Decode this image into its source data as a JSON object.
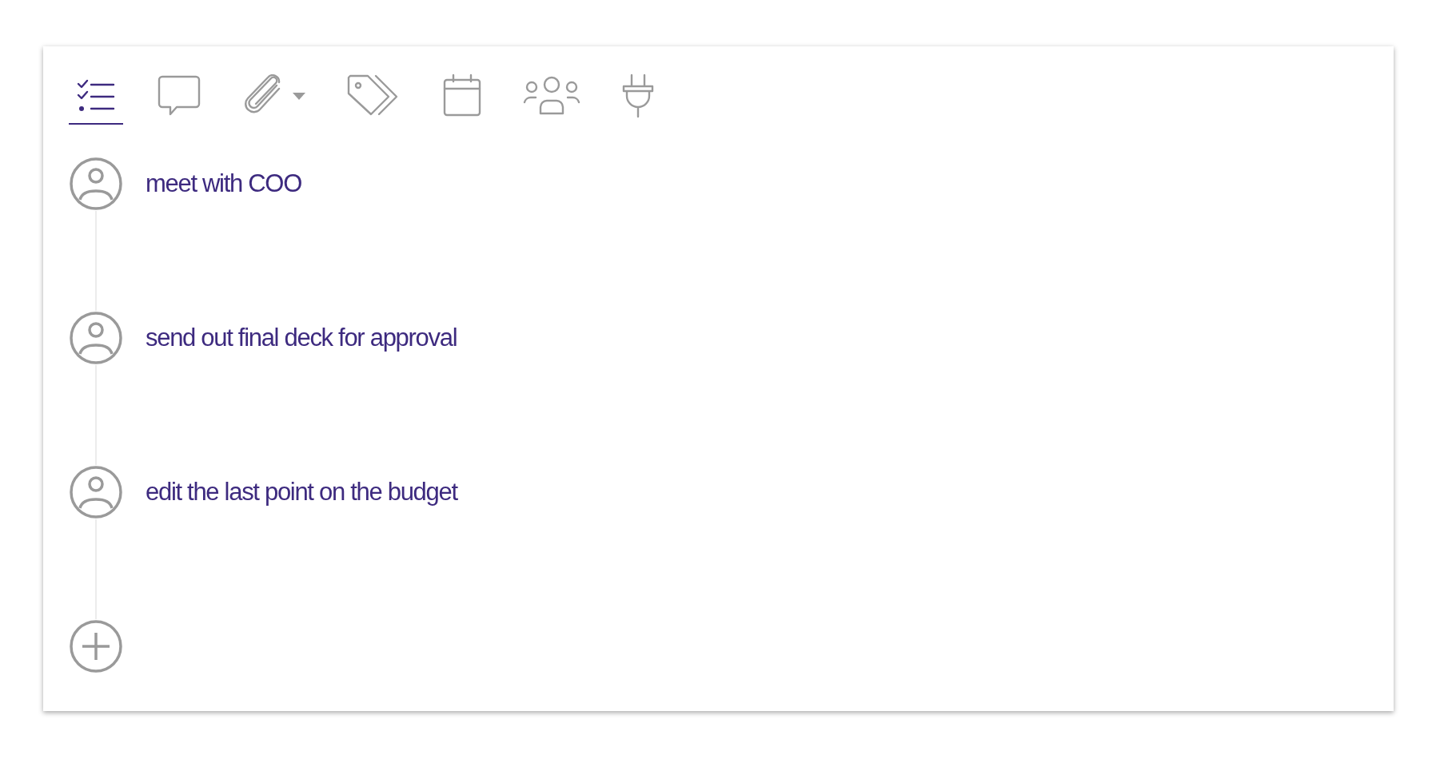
{
  "toolbar": {
    "tabs": [
      {
        "kind": "checklist",
        "selected": true,
        "has_menu": false
      },
      {
        "kind": "comments",
        "selected": false,
        "has_menu": false
      },
      {
        "kind": "attachments",
        "selected": false,
        "has_menu": true
      },
      {
        "kind": "tags",
        "selected": false,
        "has_menu": false
      },
      {
        "kind": "calendar",
        "selected": false,
        "has_menu": false
      },
      {
        "kind": "people",
        "selected": false,
        "has_menu": false
      },
      {
        "kind": "integrations",
        "selected": false,
        "has_menu": false
      }
    ]
  },
  "tasks": [
    {
      "text": "meet with COO"
    },
    {
      "text": "send out final deck for approval"
    },
    {
      "text": "edit the last point on the budget"
    }
  ]
}
